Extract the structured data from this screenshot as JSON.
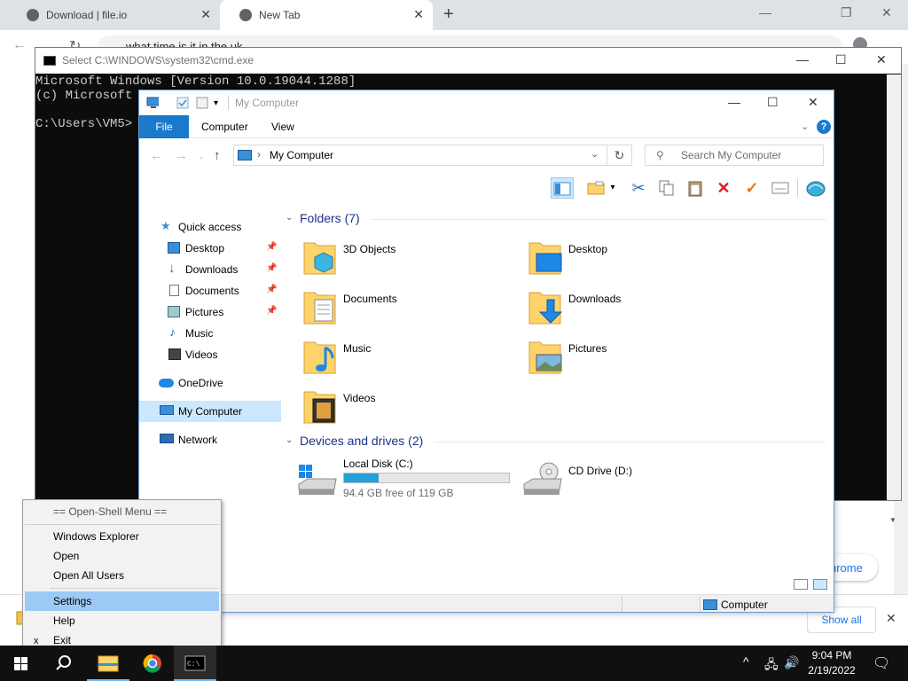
{
  "browser": {
    "tabs": [
      {
        "label": "Download | file.io"
      },
      {
        "label": "New Tab"
      }
    ],
    "omnibox_text": "what time is it in the uk",
    "side_pill": "hrome",
    "download_bar": {
      "show_all": "Show all"
    }
  },
  "cmd": {
    "title": "Select C:\\WINDOWS\\system32\\cmd.exe",
    "lines": [
      "Microsoft Windows [Version 10.0.19044.1288]",
      "(c) Microsoft C",
      "",
      "C:\\Users\\VM5>"
    ]
  },
  "explorer": {
    "title": "My Computer",
    "ribbon_tabs": {
      "file": "File",
      "computer": "Computer",
      "view": "View"
    },
    "address": "My Computer",
    "search_placeholder": "Search My Computer",
    "nav": {
      "quick_access": "Quick access",
      "desktop": "Desktop",
      "downloads": "Downloads",
      "documents": "Documents",
      "pictures": "Pictures",
      "music": "Music",
      "videos": "Videos",
      "onedrive": "OneDrive",
      "my_computer": "My Computer",
      "network": "Network"
    },
    "folders_header": "Folders (7)",
    "folders": [
      {
        "label": "3D Objects"
      },
      {
        "label": "Desktop"
      },
      {
        "label": "Documents"
      },
      {
        "label": "Downloads"
      },
      {
        "label": "Music"
      },
      {
        "label": "Pictures"
      },
      {
        "label": "Videos"
      }
    ],
    "drives_header": "Devices and drives (2)",
    "drives": {
      "c": {
        "label": "Local Disk (C:)",
        "free": "94.4 GB free of 119 GB",
        "used_fraction": 0.21
      },
      "d": {
        "label": "CD Drive (D:)"
      }
    },
    "status": "Computer"
  },
  "openshell_menu": {
    "header": "== Open-Shell Menu ==",
    "items": {
      "windows_explorer": "Windows Explorer",
      "open": "Open",
      "open_all_users": "Open All Users",
      "settings": "Settings",
      "help": "Help",
      "exit": "Exit"
    }
  },
  "taskbar": {
    "time": "9:04 PM",
    "date": "2/19/2022"
  },
  "colors": {
    "accent": "#1979ca",
    "selection": "#cce8ff",
    "menu_highlight": "#9ccaf4",
    "drive_fill": "#26a0da"
  }
}
